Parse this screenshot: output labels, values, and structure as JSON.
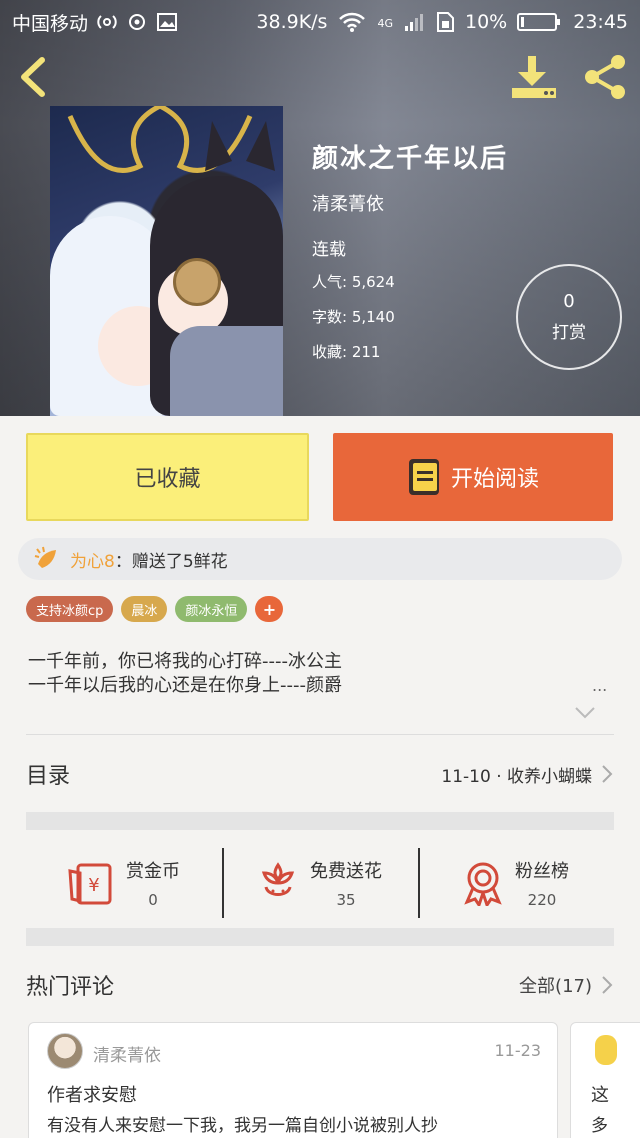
{
  "status_bar": {
    "carrier": "中国移动",
    "speed": "38.9K/s",
    "network": "4G",
    "battery": "10%",
    "battery_level": 0.1,
    "time": "23:45"
  },
  "book": {
    "title": "颜冰之千年以后",
    "author": "清柔菁依",
    "status": "连载",
    "popularity": "人气: 5,624",
    "word_count": "字数: 5,140",
    "collections": "收藏: 211"
  },
  "tip": {
    "count": "0",
    "label": "打赏"
  },
  "buttons": {
    "collected": "已收藏",
    "start_reading": "开始阅读"
  },
  "gift": {
    "user": "为心8",
    "text": "：赠送了5鲜花"
  },
  "tags": [
    {
      "label": "支持冰颜cp",
      "color": "#c9694d"
    },
    {
      "label": "晨冰",
      "color": "#d7a84d"
    },
    {
      "label": "颜冰永恒",
      "color": "#8fba6e"
    }
  ],
  "tag_add": "+",
  "intro": {
    "line1": "一千年前，你已将我的心打碎----冰公主",
    "line2": "一千年以后我的心还是在你身上----颜爵",
    "more": "..."
  },
  "toc": {
    "title": "目录",
    "latest": "11-10 · 收养小蝴蝶"
  },
  "actions": [
    {
      "label": "赏金币",
      "value": "0",
      "icon": "red-envelope-icon"
    },
    {
      "label": "免费送花",
      "value": "35",
      "icon": "flower-icon"
    },
    {
      "label": "粉丝榜",
      "value": "220",
      "icon": "medal-icon"
    }
  ],
  "comments": {
    "title": "热门评论",
    "all": "全部(17)",
    "items": [
      {
        "user": "清柔菁依",
        "date": "11-23",
        "title": "作者求安慰",
        "body": "有没有人来安慰一下我，我另一篇自创小说被别人抄"
      }
    ],
    "peek": {
      "line1": "这",
      "line2": "多"
    }
  }
}
